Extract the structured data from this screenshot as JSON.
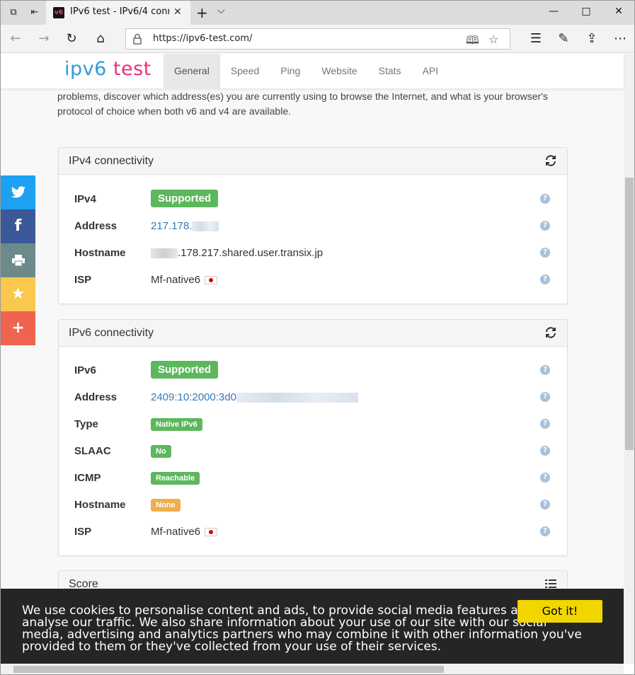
{
  "browser": {
    "tab_title": "IPv6 test - IPv6/4 conne",
    "tab_favicon": "v6",
    "url": "https://ipv6-test.com/"
  },
  "site": {
    "logo_part1": "ipv6",
    "logo_part2": "test",
    "menu": [
      {
        "label": "General"
      },
      {
        "label": "Speed"
      },
      {
        "label": "Ping"
      },
      {
        "label": "Website"
      },
      {
        "label": "Stats"
      },
      {
        "label": "API"
      }
    ],
    "intro": "problems, discover which address(es) you are currently using to browse the Internet, and what is your browser's protocol of choice when both v6 and v4 are available."
  },
  "ipv4": {
    "title": "IPv4 connectivity",
    "rows": {
      "ipv4_label": "IPv4",
      "ipv4_value": "Supported",
      "address_label": "Address",
      "address_value": "217.178.",
      "hostname_label": "Hostname",
      "hostname_value": ".178.217.shared.user.transix.jp",
      "isp_label": "ISP",
      "isp_value": "Mf-native6"
    }
  },
  "ipv6": {
    "title": "IPv6 connectivity",
    "rows": {
      "ipv6_label": "IPv6",
      "ipv6_value": "Supported",
      "address_label": "Address",
      "address_value": "2409:10:2000:3d0",
      "type_label": "Type",
      "type_value": "Native IPv6",
      "slaac_label": "SLAAC",
      "slaac_value": "No",
      "icmp_label": "ICMP",
      "icmp_value": "Reachable",
      "hostname_label": "Hostname",
      "hostname_value": "None",
      "isp_label": "ISP",
      "isp_value": "Mf-native6"
    }
  },
  "score": {
    "title": "Score"
  },
  "help_glyph": "?",
  "cookie": {
    "text": "We use cookies to personalise content and ads, to provide social media features and to analyse our traffic. We also share information about your use of our site with our social media, advertising and analytics partners who may combine it with other information you've provided to them or they've collected from your use of their services.",
    "button": "Got it!"
  },
  "colors": {
    "success": "#5cb85c",
    "warning": "#f0ad4e",
    "link": "#337ab7",
    "twitter": "#1da1f2",
    "facebook": "#3b5998",
    "print": "#6d8a8a",
    "favorite": "#f9c84d",
    "more": "#f0634f",
    "cookie_button": "#f1d600"
  }
}
